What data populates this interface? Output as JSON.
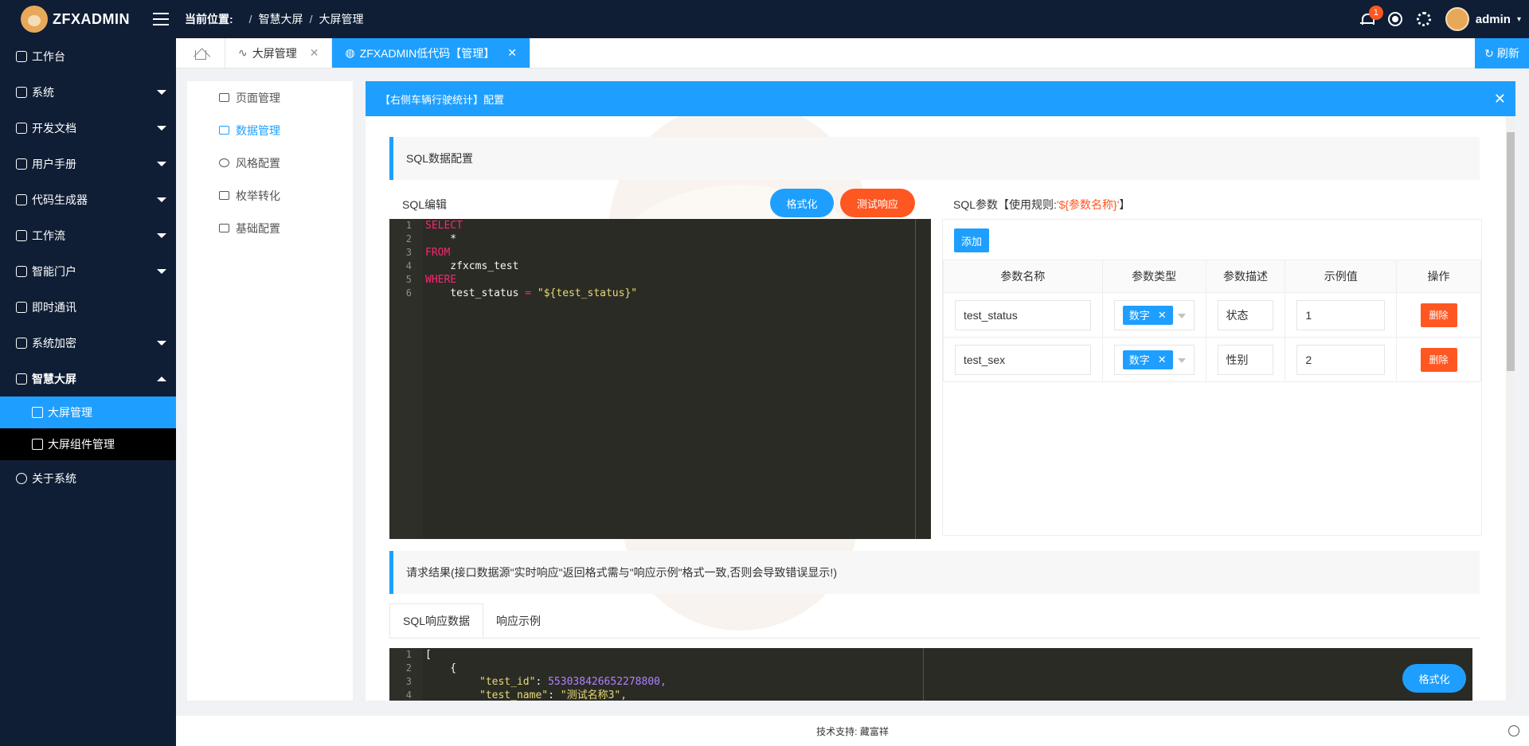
{
  "app": {
    "name": "ZFXADMIN"
  },
  "header": {
    "breadcrumb_label": "当前位置:",
    "breadcrumb": [
      "智慧大屏",
      "大屏管理"
    ],
    "notification_count": "1",
    "user_name": "admin"
  },
  "sidebar": {
    "items": [
      {
        "label": "工作台",
        "icon": "house-icon"
      },
      {
        "label": "系统",
        "icon": "grid-icon"
      },
      {
        "label": "开发文档",
        "icon": "book-icon"
      },
      {
        "label": "用户手册",
        "icon": "manual-icon"
      },
      {
        "label": "代码生成器",
        "icon": "code-icon"
      },
      {
        "label": "工作流",
        "icon": "flow-icon"
      },
      {
        "label": "智能门户",
        "icon": "globe-icon"
      },
      {
        "label": "即时通讯",
        "icon": "chat-icon"
      },
      {
        "label": "系统加密",
        "icon": "key-icon"
      },
      {
        "label": "智慧大屏",
        "icon": "screen-icon"
      },
      {
        "label": "关于系统",
        "icon": "info-icon"
      }
    ],
    "sub_items": [
      {
        "label": "大屏管理"
      },
      {
        "label": "大屏组件管理"
      }
    ]
  },
  "tabs": {
    "items": [
      {
        "label": "大屏管理"
      },
      {
        "label": "ZFXADMIN低代码【管理】"
      }
    ],
    "refresh_label": "刷新"
  },
  "left_panel": {
    "items": [
      {
        "label": "页面管理"
      },
      {
        "label": "数据管理"
      },
      {
        "label": "风格配置"
      },
      {
        "label": "枚举转化"
      },
      {
        "label": "基础配置"
      }
    ]
  },
  "panel": {
    "title": "【右侧车辆行驶统计】配置",
    "sql_section_title": "SQL数据配置",
    "sql_edit_label": "SQL编辑",
    "format_button": "格式化",
    "test_button": "测试响应",
    "param_label_prefix": "SQL参数【使用规则:",
    "param_rule": "'${参数名称}'",
    "param_label_suffix": "】",
    "add_button": "添加",
    "param_columns": [
      "参数名称",
      "参数类型",
      "参数描述",
      "示例值",
      "操作"
    ],
    "params": [
      {
        "name": "test_status",
        "type": "数字",
        "desc": "状态",
        "example": "1",
        "action": "删除"
      },
      {
        "name": "test_sex",
        "type": "数字",
        "desc": "性别",
        "example": "2",
        "action": "删除"
      }
    ],
    "result_section_title": "请求结果(接口数据源\"实时响应\"返回格式需与\"响应示例\"格式一致,否则会导致错误显示!)",
    "result_tabs": [
      "SQL响应数据",
      "响应示例"
    ],
    "result_format_button": "格式化"
  },
  "sql_code": {
    "lines": [
      {
        "n": "1",
        "text": "SELECT",
        "kind": "kw"
      },
      {
        "n": "2",
        "text": "    *",
        "kind": "plain"
      },
      {
        "n": "3",
        "text": "FROM",
        "kind": "kw"
      },
      {
        "n": "4",
        "text": "    zfxcms_test",
        "kind": "plain"
      },
      {
        "n": "5",
        "text": "WHERE",
        "kind": "kw"
      },
      {
        "n": "6",
        "text": "    test_status = \"${test_status}\"",
        "kind": "mixed"
      }
    ]
  },
  "result_code": {
    "lines": [
      {
        "n": "1",
        "text": "["
      },
      {
        "n": "2",
        "text": "    {"
      },
      {
        "n": "3",
        "key": "\"test_id\"",
        "value": "553038426652278800,"
      },
      {
        "n": "4",
        "key": "\"test_name\"",
        "value": "\"测试名称3\","
      }
    ]
  },
  "footer": {
    "text": "技术支持: 藏富祥"
  }
}
